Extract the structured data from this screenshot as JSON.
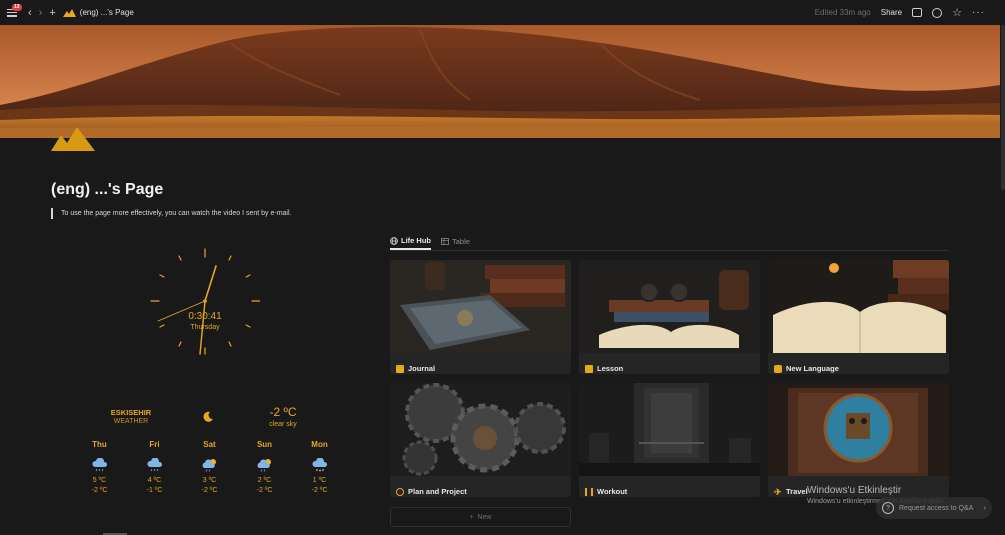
{
  "topbar": {
    "notification_count": "13",
    "breadcrumb_title": "(eng) ...'s Page",
    "edited": "Edited 33m ago",
    "share_label": "Share"
  },
  "page": {
    "title": "(eng) ...'s Page",
    "callout": "To use the page more effectively, you can watch the video I sent by e-mail."
  },
  "clock": {
    "time": "0:30:41",
    "day": "Thursday"
  },
  "weather": {
    "city": "ESKISEHIR",
    "label": "WEATHER",
    "current_temp": "-2 ºC",
    "current_desc": "clear sky",
    "forecast": [
      {
        "day": "Thu",
        "high": "5 ºC",
        "low": "-2 ºC",
        "icon": "rain-cloud-icon"
      },
      {
        "day": "Fri",
        "high": "4 ºC",
        "low": "-1 ºC",
        "icon": "rain-cloud-icon"
      },
      {
        "day": "Sat",
        "high": "3 ºC",
        "low": "-2 ºC",
        "icon": "sun-cloud-rain-icon"
      },
      {
        "day": "Sun",
        "high": "2 ºC",
        "low": "-2 ºC",
        "icon": "sun-cloud-rain-icon"
      },
      {
        "day": "Mon",
        "high": "1 ºC",
        "low": "-2 ºC",
        "icon": "snow-cloud-icon"
      }
    ]
  },
  "gallery": {
    "tabs": [
      {
        "label": "Life Hub",
        "active": true,
        "icon": "globe-icon"
      },
      {
        "label": "Table",
        "active": false,
        "icon": "table-icon"
      }
    ],
    "cards": [
      {
        "label": "Journal",
        "icon": "book-icon"
      },
      {
        "label": "Lesson",
        "icon": "book-icon"
      },
      {
        "label": "New Language",
        "icon": "language-icon"
      },
      {
        "label": "Plan and Project",
        "icon": "gears-icon"
      },
      {
        "label": "Workout",
        "icon": "dumbbell-icon"
      },
      {
        "label": "Travel",
        "icon": "airplane-icon"
      }
    ],
    "new_label": "New"
  },
  "windows_overlay": {
    "title": "Windows'u Etkinleştir",
    "subtitle": "Windows'u etkinleştirmek için Ayarlar'a gidin.",
    "qa_label": "Request access to Q&A"
  },
  "colors": {
    "background": "#191919",
    "accent": "#e8a81b",
    "card": "#252525"
  }
}
